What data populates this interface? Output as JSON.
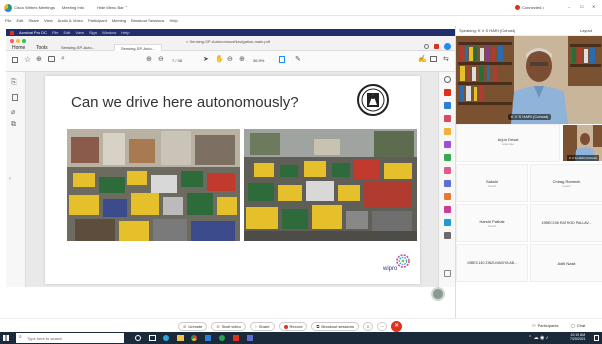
{
  "window": {
    "title": "Cisco Webex Meetings",
    "title_sep": "Meeting Info",
    "title_more": "Hide Menu Bar ⌃",
    "status": "Connected •",
    "controls": [
      "–",
      "☐",
      "✕"
    ]
  },
  "menubar": {
    "items": [
      "File",
      "Edit",
      "Share",
      "View",
      "Audio & Video",
      "Participant",
      "Meeting",
      "Breakout Sessions",
      "Help"
    ]
  },
  "share_strip": {
    "app": "Acrobat Pro DC",
    "items": [
      "File",
      "Edit",
      "View",
      "Sign",
      "Window",
      "Help"
    ]
  },
  "acrobat": {
    "doc_title": "×  Sensing-SP-AutonomousNavigation-main.pdf",
    "tabs": [
      "Home",
      "Tools",
      "Sensing-SP-Auto...",
      "Sensing-SP-Auto..."
    ],
    "page_counter": "7 / 38",
    "zoom": "36.9%"
  },
  "slide": {
    "title": "Can we drive here autonomously?",
    "brand": "wipro"
  },
  "speaking": {
    "label": "Speaking: K V S HARI (Cohost)",
    "layout": "Layout"
  },
  "main_video": {
    "caption": "K V S HARI (Cohost)"
  },
  "self_view": {
    "caption": "K V S HARI (Cohost)"
  },
  "participants": [
    {
      "name": "Arjun Desai",
      "role": "Attendee"
    },
    {
      "name": "Sakshi",
      "role": "Guest"
    },
    {
      "name": "Chirag Ramesh",
      "role": "Guest"
    },
    {
      "name": "Harshi Pathak",
      "role": "Guest"
    },
    {
      "name": "19BEC106 RATHOD PALLAV...",
      "role": ""
    },
    {
      "name": "19BEC140 ZINZUVADIYA AB...",
      "role": ""
    },
    {
      "name": "Aditi Nasit",
      "role": ""
    }
  ],
  "controls": {
    "unmute": "Unmute",
    "start_video": "Start video",
    "share": "Share",
    "record": "Record",
    "breakout": "Breakout sessions",
    "participants": "Participants",
    "chat": "Chat"
  },
  "taskbar": {
    "search": "Type here to search",
    "time": "10:10 AM",
    "date": "7/20/2021"
  },
  "colors": {
    "share_strip": "#222d6b",
    "webex_green": "#2e9e5b",
    "end_red": "#e0301e",
    "record_red": "#d9342b",
    "taskbar": "#1b2a3a"
  }
}
